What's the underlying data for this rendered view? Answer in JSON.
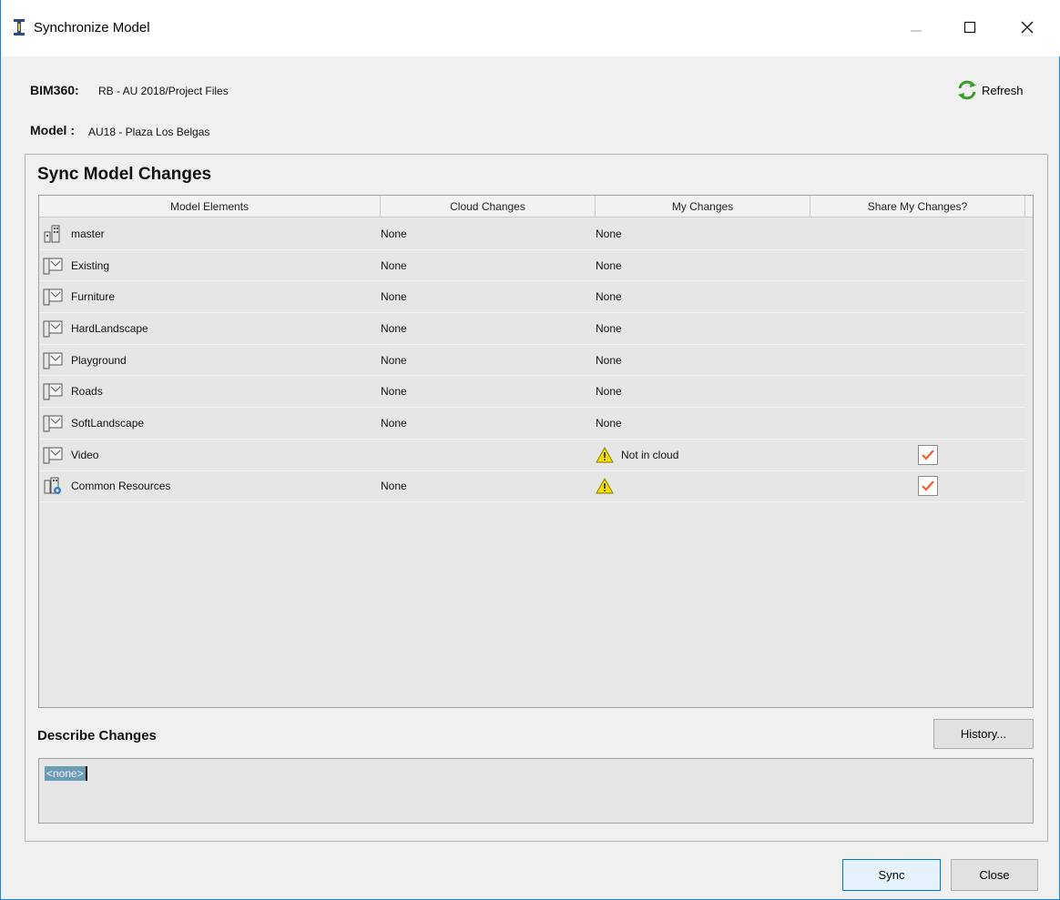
{
  "window": {
    "title": "Synchronize Model",
    "controls": {
      "minimize": "minimize-icon",
      "maximize": "maximize-icon",
      "close": "close-icon"
    }
  },
  "info": {
    "bim360_label": "BIM360:",
    "bim360_value": "RB - AU 2018/Project Files",
    "model_label": "Model :",
    "model_value": "AU18 - Plaza Los Belgas"
  },
  "refresh": {
    "label": "Refresh",
    "icon": "refresh-icon",
    "color": "#3a9a2a"
  },
  "sync_changes": {
    "title": "Sync Model Changes",
    "columns": [
      "Model Elements",
      "Cloud Changes",
      "My Changes",
      "Share My Changes?"
    ],
    "rows": [
      {
        "name": "master",
        "icon": "building-icon",
        "cloud": "None",
        "mine": "None",
        "mine_warning": false,
        "share_checkbox": false,
        "share_checked": false
      },
      {
        "name": "Existing",
        "icon": "model-icon",
        "cloud": "None",
        "mine": "None",
        "mine_warning": false,
        "share_checkbox": false,
        "share_checked": false
      },
      {
        "name": "Furniture",
        "icon": "model-icon",
        "cloud": "None",
        "mine": "None",
        "mine_warning": false,
        "share_checkbox": false,
        "share_checked": false
      },
      {
        "name": "HardLandscape",
        "icon": "model-icon",
        "cloud": "None",
        "mine": "None",
        "mine_warning": false,
        "share_checkbox": false,
        "share_checked": false
      },
      {
        "name": "Playground",
        "icon": "model-icon",
        "cloud": "None",
        "mine": "None",
        "mine_warning": false,
        "share_checkbox": false,
        "share_checked": false
      },
      {
        "name": "Roads",
        "icon": "model-icon",
        "cloud": "None",
        "mine": "None",
        "mine_warning": false,
        "share_checkbox": false,
        "share_checked": false
      },
      {
        "name": "SoftLandscape",
        "icon": "model-icon",
        "cloud": "None",
        "mine": "None",
        "mine_warning": false,
        "share_checkbox": false,
        "share_checked": false
      },
      {
        "name": "Video",
        "icon": "model-icon",
        "cloud": "",
        "mine": "Not in cloud",
        "mine_warning": true,
        "share_checkbox": true,
        "share_checked": true
      },
      {
        "name": "Common Resources",
        "icon": "resources-icon",
        "cloud": "None",
        "mine": "",
        "mine_warning": true,
        "share_checkbox": true,
        "share_checked": true
      }
    ]
  },
  "describe": {
    "label": "Describe Changes",
    "history_button": "History...",
    "text": "<none>"
  },
  "buttons": {
    "sync": "Sync",
    "close": "Close"
  },
  "colors": {
    "accent": "#0078d7",
    "warning": "#f7e000",
    "check": "#e8602c"
  }
}
